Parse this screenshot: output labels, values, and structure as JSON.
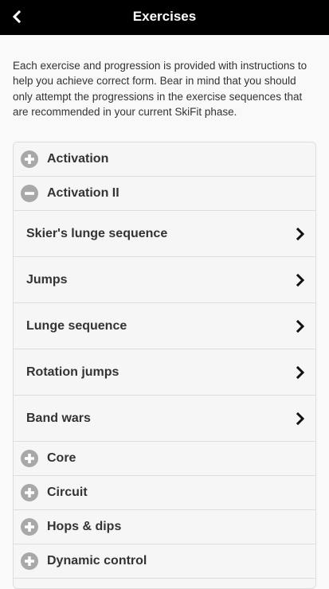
{
  "header": {
    "title": "Exercises"
  },
  "intro": "Each exercise and progression is provided with instructions to help you achieve correct form. Bear in mind that you should only attempt the progressions in the exercise sequences that are recommended in your current SkiFit phase.",
  "categories": [
    {
      "label": "Activation",
      "state": "collapsed",
      "icon": "plus-circle-icon"
    },
    {
      "label": "Activation II",
      "state": "expanded",
      "icon": "minus-circle-icon"
    },
    {
      "label": "Core",
      "state": "collapsed",
      "icon": "plus-circle-icon"
    },
    {
      "label": "Circuit",
      "state": "collapsed",
      "icon": "plus-circle-icon"
    },
    {
      "label": "Hops & dips",
      "state": "collapsed",
      "icon": "plus-circle-icon"
    },
    {
      "label": "Dynamic control",
      "state": "collapsed",
      "icon": "plus-circle-icon"
    }
  ],
  "activation_ii_items": [
    {
      "label": "Skier's lunge sequence"
    },
    {
      "label": "Jumps"
    },
    {
      "label": "Lunge sequence"
    },
    {
      "label": "Rotation jumps"
    },
    {
      "label": "Band wars"
    }
  ],
  "colors": {
    "header_bg": "#000000",
    "page_bg": "#f9f9f9",
    "icon_grey": "#a8a8a8"
  }
}
